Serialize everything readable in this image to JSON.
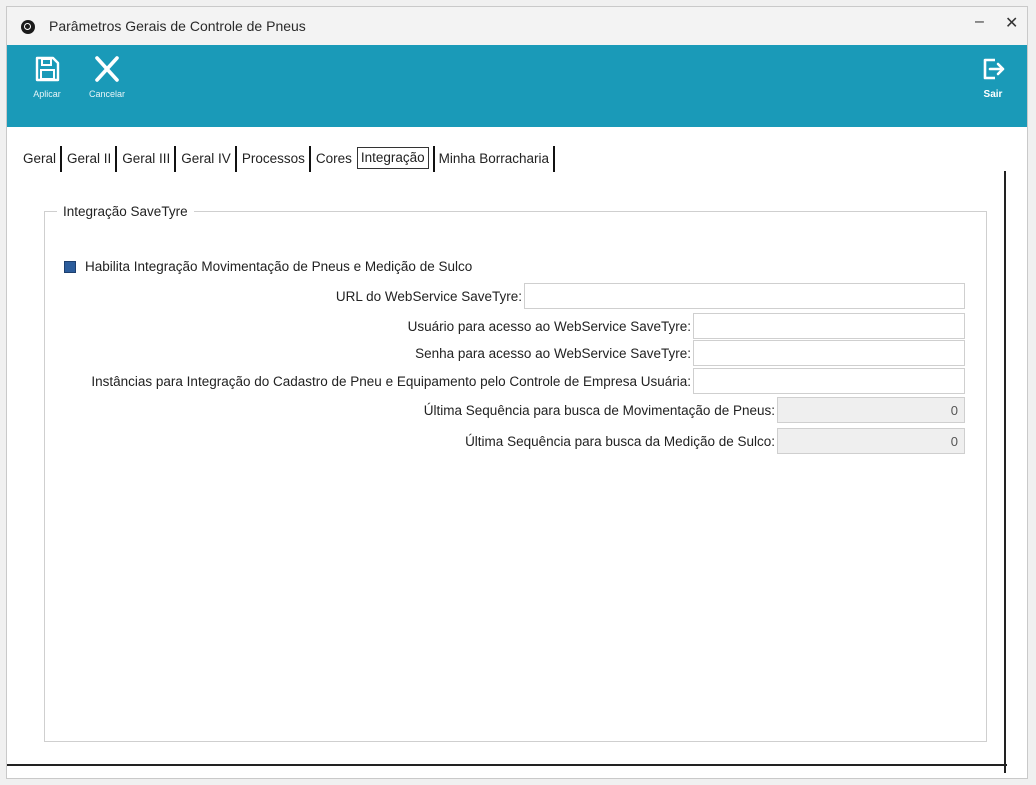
{
  "window": {
    "title": "Parâmetros Gerais de Controle de Pneus",
    "minimize": "–",
    "close": "✕"
  },
  "toolbar": {
    "apply_label": "Aplicar",
    "cancel_label": "Cancelar",
    "exit_label": "Sair",
    "accent_color": "#1a9ab8"
  },
  "tabs": [
    {
      "label": "Geral"
    },
    {
      "label": "Geral II"
    },
    {
      "label": "Geral III"
    },
    {
      "label": "Geral IV"
    },
    {
      "label": "Processos"
    },
    {
      "label": "Cores"
    },
    {
      "label": "Integração",
      "active": true
    },
    {
      "label": "Minha Borracharia"
    }
  ],
  "group": {
    "legend": "Integração SaveTyre",
    "checkbox_label": "Habilita Integração Movimentação de Pneus e Medição de Sulco",
    "checkbox_checked": true,
    "fields": {
      "url_label": "URL do WebService SaveTyre:",
      "url_value": "",
      "user_label": "Usuário para acesso ao WebService SaveTyre:",
      "user_value": "",
      "password_label": "Senha para acesso ao WebService SaveTyre:",
      "password_value": "",
      "instances_label": "Instâncias para Integração do Cadastro de Pneu e Equipamento pelo Controle de Empresa Usuária:",
      "instances_value": "",
      "last_seq_mov_label": "Última Sequência para busca de Movimentação de Pneus:",
      "last_seq_mov_value": "0",
      "last_seq_sulco_label": "Última Sequência para busca da Medição de Sulco:",
      "last_seq_sulco_value": "0"
    }
  }
}
